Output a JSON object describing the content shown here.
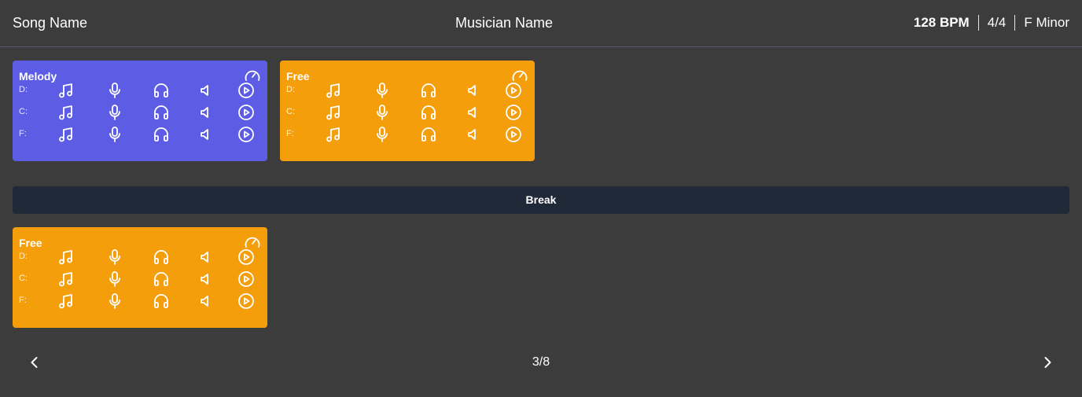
{
  "header": {
    "song_name": "Song Name",
    "musician_name": "Musician Name",
    "bpm": "128 BPM",
    "time_signature": "4/4",
    "key": "F Minor"
  },
  "colors": {
    "background": "#3c3c3c",
    "melody_card": "#5c5ce5",
    "free_card": "#f59e0b",
    "break_bar": "#1f2937"
  },
  "cards": [
    {
      "title": "Melody",
      "color": "#5c5ce5",
      "tempo_icon": "speedometer-icon",
      "rows": [
        {
          "label": "D:"
        },
        {
          "label": "C:"
        },
        {
          "label": "F:"
        }
      ]
    },
    {
      "title": "Free",
      "color": "#f59e0b",
      "tempo_icon": "speedometer-icon",
      "rows": [
        {
          "label": "D:"
        },
        {
          "label": "C:"
        },
        {
          "label": "F:"
        }
      ]
    },
    {
      "title": "Free",
      "color": "#f59e0b",
      "tempo_icon": "speedometer-icon",
      "rows": [
        {
          "label": "D:"
        },
        {
          "label": "C:"
        },
        {
          "label": "F:"
        }
      ]
    }
  ],
  "row_icons": [
    "music-note-icon",
    "microphone-icon",
    "headphones-icon",
    "speaker-icon",
    "play-circle-icon"
  ],
  "break": {
    "label": "Break"
  },
  "pagination": {
    "label": "3/8",
    "current": 3,
    "total": 8,
    "prev_icon": "chevron-left-icon",
    "next_icon": "chevron-right-icon"
  }
}
